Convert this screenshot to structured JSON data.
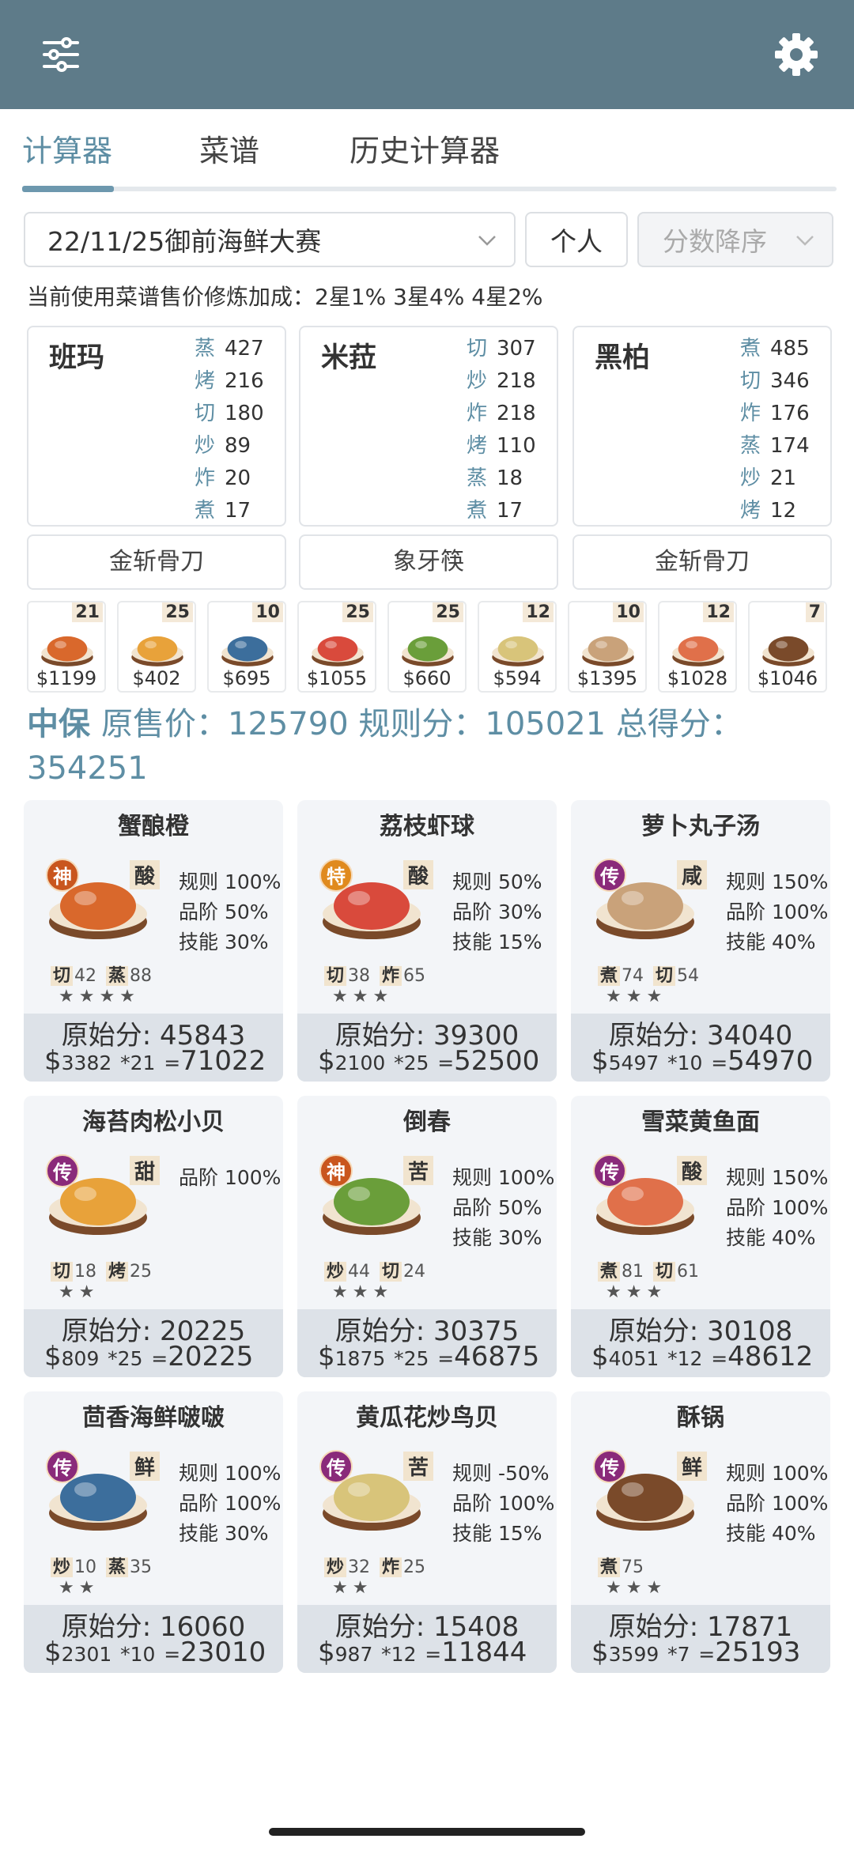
{
  "app_bar": {
    "left_icon": "sliders-icon",
    "right_icon": "gear-icon"
  },
  "tabs": [
    {
      "label": "计算器",
      "active": true
    },
    {
      "label": "菜谱",
      "active": false
    },
    {
      "label": "历史计算器",
      "active": false
    }
  ],
  "filters": {
    "event": "22/11/25御前海鲜大赛",
    "mode": "个人",
    "sort": "分数降序"
  },
  "note": "当前使用菜谱售价修炼加成：2星1% 3星4% 4星2%",
  "chefs": [
    {
      "name": "班玛",
      "skills": [
        {
          "k": "蒸",
          "v": "427"
        },
        {
          "k": "烤",
          "v": "216"
        },
        {
          "k": "切",
          "v": "180"
        },
        {
          "k": "炒",
          "v": "89"
        },
        {
          "k": "炸",
          "v": "20"
        },
        {
          "k": "煮",
          "v": "17"
        }
      ],
      "tool": "金斩骨刀"
    },
    {
      "name": "米菈",
      "skills": [
        {
          "k": "切",
          "v": "307"
        },
        {
          "k": "炒",
          "v": "218"
        },
        {
          "k": "炸",
          "v": "218"
        },
        {
          "k": "烤",
          "v": "110"
        },
        {
          "k": "蒸",
          "v": "18"
        },
        {
          "k": "煮",
          "v": "17"
        }
      ],
      "tool": "象牙筷"
    },
    {
      "name": "黑柏",
      "skills": [
        {
          "k": "煮",
          "v": "485"
        },
        {
          "k": "切",
          "v": "346"
        },
        {
          "k": "炸",
          "v": "176"
        },
        {
          "k": "蒸",
          "v": "174"
        },
        {
          "k": "炒",
          "v": "21"
        },
        {
          "k": "烤",
          "v": "12"
        }
      ],
      "tool": "金斩骨刀"
    }
  ],
  "recipe_strip": [
    {
      "qty": "21",
      "price": "$1199",
      "color": "#d9682c"
    },
    {
      "qty": "25",
      "price": "$402",
      "color": "#e8a23a"
    },
    {
      "qty": "10",
      "price": "$695",
      "color": "#3c6e9c"
    },
    {
      "qty": "25",
      "price": "$1055",
      "color": "#d94a3c"
    },
    {
      "qty": "25",
      "price": "$660",
      "color": "#6a9e3a"
    },
    {
      "qty": "12",
      "price": "$594",
      "color": "#d8c47a"
    },
    {
      "qty": "10",
      "price": "$1395",
      "color": "#c9a27a"
    },
    {
      "qty": "12",
      "price": "$1028",
      "color": "#e0704a"
    },
    {
      "qty": "7",
      "price": "$1046",
      "color": "#7a4a2a"
    }
  ],
  "summary": {
    "level": "中保",
    "text": "原售价：125790 规则分：105021 总得分：354251"
  },
  "cards": [
    {
      "title": "蟹酿橙",
      "badge": "神",
      "badge_color": "#c9561e",
      "taste": "酸",
      "stats": [
        "规则 100%",
        "品阶 50%",
        "技能 30%"
      ],
      "skills": [
        {
          "k": "切",
          "v": "42"
        },
        {
          "k": "蒸",
          "v": "88"
        }
      ],
      "stars": "★★★★",
      "orig": "原始分: 45843",
      "price": "3382",
      "mult": "*21",
      "total": "71022",
      "dish_color": "#d9682c"
    },
    {
      "title": "荔枝虾球",
      "badge": "特",
      "badge_color": "#e08a1e",
      "taste": "酸",
      "stats": [
        "规则 50%",
        "品阶 30%",
        "技能 15%"
      ],
      "skills": [
        {
          "k": "切",
          "v": "38"
        },
        {
          "k": "炸",
          "v": "65"
        }
      ],
      "stars": "★★★",
      "orig": "原始分: 39300",
      "price": "2100",
      "mult": "*25",
      "total": "52500",
      "dish_color": "#d94a3c"
    },
    {
      "title": "萝卜丸子汤",
      "badge": "传",
      "badge_color": "#8a2a7a",
      "taste": "咸",
      "stats": [
        "规则 150%",
        "品阶 100%",
        "技能 40%"
      ],
      "skills": [
        {
          "k": "煮",
          "v": "74"
        },
        {
          "k": "切",
          "v": "54"
        }
      ],
      "stars": "★★★",
      "orig": "原始分: 34040",
      "price": "5497",
      "mult": "*10",
      "total": "54970",
      "dish_color": "#c9a27a"
    },
    {
      "title": "海苔肉松小贝",
      "badge": "传",
      "badge_color": "#8a2a7a",
      "taste": "甜",
      "stats": [
        "品阶 100%"
      ],
      "skills": [
        {
          "k": "切",
          "v": "18"
        },
        {
          "k": "烤",
          "v": "25"
        }
      ],
      "stars": "★★",
      "orig": "原始分: 20225",
      "price": "809",
      "mult": "*25",
      "total": "20225",
      "dish_color": "#e8a23a"
    },
    {
      "title": "倒春",
      "badge": "神",
      "badge_color": "#c9561e",
      "taste": "苦",
      "stats": [
        "规则 100%",
        "品阶 50%",
        "技能 30%"
      ],
      "skills": [
        {
          "k": "炒",
          "v": "44"
        },
        {
          "k": "切",
          "v": "24"
        }
      ],
      "stars": "★★★",
      "orig": "原始分: 30375",
      "price": "1875",
      "mult": "*25",
      "total": "46875",
      "dish_color": "#6a9e3a"
    },
    {
      "title": "雪菜黄鱼面",
      "badge": "传",
      "badge_color": "#8a2a7a",
      "taste": "酸",
      "stats": [
        "规则 150%",
        "品阶 100%",
        "技能 40%"
      ],
      "skills": [
        {
          "k": "煮",
          "v": "81"
        },
        {
          "k": "切",
          "v": "61"
        }
      ],
      "stars": "★★★",
      "orig": "原始分: 30108",
      "price": "4051",
      "mult": "*12",
      "total": "48612",
      "dish_color": "#e0704a"
    },
    {
      "title": "茴香海鲜啵啵",
      "badge": "传",
      "badge_color": "#8a2a7a",
      "taste": "鲜",
      "stats": [
        "规则 100%",
        "品阶 100%",
        "技能 30%"
      ],
      "skills": [
        {
          "k": "炒",
          "v": "10"
        },
        {
          "k": "蒸",
          "v": "35"
        }
      ],
      "stars": "★★",
      "orig": "原始分: 16060",
      "price": "2301",
      "mult": "*10",
      "total": "23010",
      "dish_color": "#3c6e9c"
    },
    {
      "title": "黄瓜花炒鸟贝",
      "badge": "传",
      "badge_color": "#8a2a7a",
      "taste": "苦",
      "stats": [
        "规则 -50%",
        "品阶 100%",
        "技能 15%"
      ],
      "skills": [
        {
          "k": "炒",
          "v": "32"
        },
        {
          "k": "炸",
          "v": "25"
        }
      ],
      "stars": "★★",
      "orig": "原始分: 15408",
      "price": "987",
      "mult": "*12",
      "total": "11844",
      "dish_color": "#d8c47a"
    },
    {
      "title": "酥锅",
      "badge": "传",
      "badge_color": "#8a2a7a",
      "taste": "鲜",
      "stats": [
        "规则 100%",
        "品阶 100%",
        "技能 40%"
      ],
      "skills": [
        {
          "k": "煮",
          "v": "75"
        }
      ],
      "stars": "★★★",
      "orig": "原始分: 17871",
      "price": "3599",
      "mult": "*7",
      "total": "25193",
      "dish_color": "#7a4a2a"
    }
  ]
}
